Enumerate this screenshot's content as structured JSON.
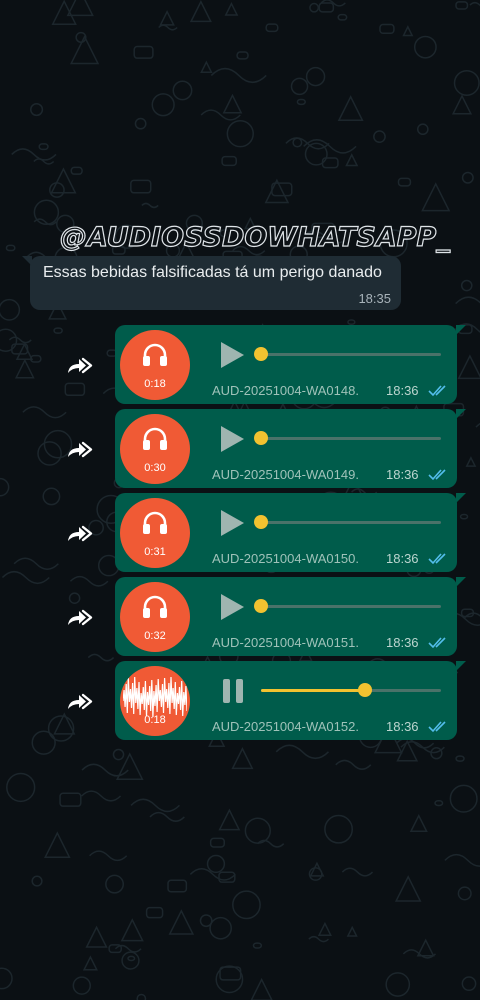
{
  "watermark": "@AUDIOSSDOWHATSAPP_",
  "incoming_message": {
    "text": "Essas bebidas falsificadas tá um perigo danado",
    "time": "18:35"
  },
  "audio_messages": [
    {
      "duration": "0:18",
      "filename": "AUD-20251004-WA0148.",
      "time": "18:36",
      "state": "play",
      "progress": 0.0
    },
    {
      "duration": "0:30",
      "filename": "AUD-20251004-WA0149.",
      "time": "18:36",
      "state": "play",
      "progress": 0.0
    },
    {
      "duration": "0:31",
      "filename": "AUD-20251004-WA0150.",
      "time": "18:36",
      "state": "play",
      "progress": 0.0
    },
    {
      "duration": "0:32",
      "filename": "AUD-20251004-WA0151.",
      "time": "18:36",
      "state": "play",
      "progress": 0.0
    },
    {
      "duration": "0:18",
      "filename": "AUD-20251004-WA0152.",
      "time": "18:36",
      "state": "playing",
      "progress": 0.58
    }
  ],
  "icons": {
    "forward": "forward-arrow-icon",
    "headphone": "headphone-icon",
    "play": "play-icon",
    "pause": "pause-icon",
    "read": "double-check-icon",
    "waveform": "waveform-icon"
  },
  "colors": {
    "background": "#0b1014",
    "incoming_bubble": "#1f2c34",
    "outgoing_bubble": "#005c4b",
    "avatar": "#f05a35",
    "progress_accent": "#f2c230",
    "read_ticks": "#53bdeb"
  }
}
